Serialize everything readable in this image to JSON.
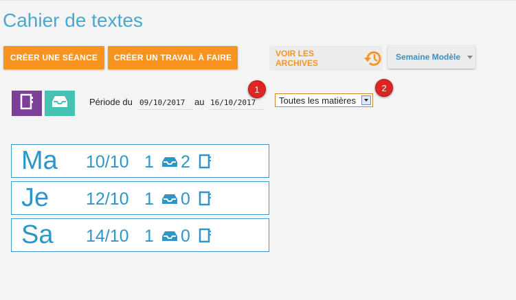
{
  "page": {
    "title": "Cahier de textes"
  },
  "toolbar": {
    "create_session_label": "CRÉER UNE SÉANCE",
    "create_work_label": "CRÉER UN TRAVAIL À FAIRE",
    "archives_label": "VOIR LES ARCHIVES",
    "week_model_label": "Semaine Modèle"
  },
  "views": [
    {
      "name": "notebook-view",
      "color": "#7b3f98"
    },
    {
      "name": "inbox-view",
      "color": "#45c2b1"
    }
  ],
  "filters": {
    "period_label": "Période du",
    "from_date": "09/10/2017",
    "to_label": "au",
    "to_date": "16/10/2017",
    "subject_selected": "Toutes les matières"
  },
  "badges": [
    "1",
    "2"
  ],
  "days": [
    {
      "day": "Ma",
      "date": "10/10",
      "count1": "1",
      "count2": "2"
    },
    {
      "day": "Je",
      "date": "12/10",
      "count1": "1",
      "count2": "0"
    },
    {
      "day": "Sa",
      "date": "14/10",
      "count1": "1",
      "count2": "0"
    }
  ],
  "colors": {
    "accent_orange": "#f7931e",
    "title_blue": "#4aa8d0",
    "card_blue": "#2f95c7",
    "badge_red": "#e02424"
  }
}
